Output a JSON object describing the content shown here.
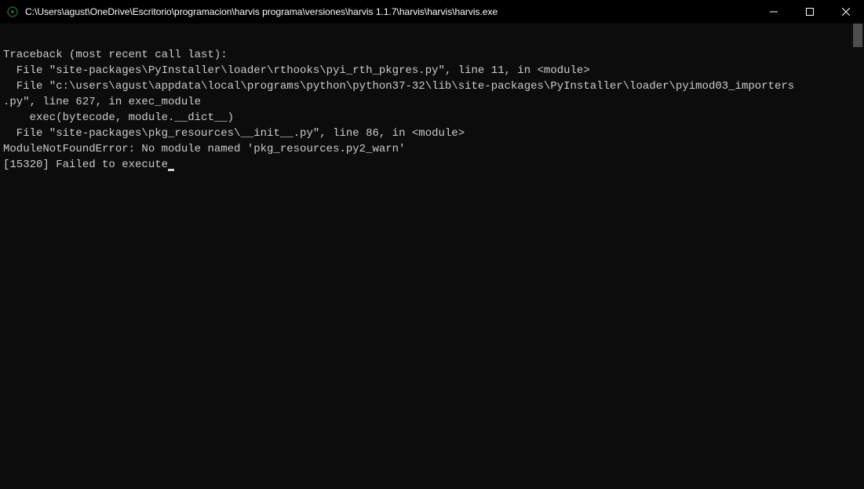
{
  "window": {
    "title": "C:\\Users\\agust\\OneDrive\\Escritorio\\programacion\\harvis programa\\versiones\\harvis 1.1.7\\harvis\\harvis\\harvis.exe"
  },
  "terminal": {
    "lines": [
      "Traceback (most recent call last):",
      "  File \"site-packages\\PyInstaller\\loader\\rthooks\\pyi_rth_pkgres.py\", line 11, in <module>",
      "  File \"c:\\users\\agust\\appdata\\local\\programs\\python\\python37-32\\lib\\site-packages\\PyInstaller\\loader\\pyimod03_importers",
      ".py\", line 627, in exec_module",
      "    exec(bytecode, module.__dict__)",
      "  File \"site-packages\\pkg_resources\\__init__.py\", line 86, in <module>",
      "ModuleNotFoundError: No module named 'pkg_resources.py2_warn'",
      "[15320] Failed to execute"
    ]
  }
}
